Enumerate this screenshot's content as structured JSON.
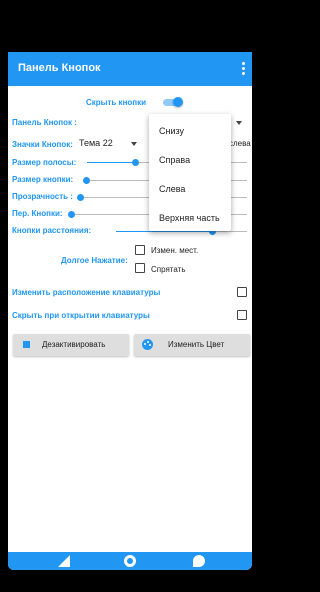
{
  "app": {
    "title": "Панель Кнопок"
  },
  "settings": {
    "hide_buttons_label": "Скрыть кнопки",
    "hide_buttons_on": true,
    "panel_label": "Панель Кнопок :",
    "icons_label": "Значки Кнопок:",
    "icons_theme": "Тема 22",
    "icons_partial_right": "слева",
    "sliders": [
      {
        "label": "Размер полосы:",
        "value": 0.32
      },
      {
        "label": "Размер кнопки:",
        "value": 0.02
      },
      {
        "label": "Прозрачность :",
        "value": 0.0
      },
      {
        "label": "Пер. Кнопки:",
        "value": 0.0
      },
      {
        "label": "Кнопки расстояния:",
        "value": 0.65
      }
    ],
    "long_press_label": "Долгое Нажатие:",
    "long_press_options": [
      {
        "label": "Измен. мест.",
        "checked": false
      },
      {
        "label": "Спрятать",
        "checked": false
      }
    ],
    "toggle_rows": [
      {
        "label": "Изменить расположение клавиатуры",
        "checked": false
      },
      {
        "label": "Скрыть при открытии клавиатуры",
        "checked": false
      }
    ],
    "buttons": {
      "deactivate": "Дезактивировать",
      "change_color": "Изменить Цвет"
    }
  },
  "dropdown": {
    "options": [
      "Снизу",
      "Справа",
      "Слева",
      "Верхняя часть"
    ]
  },
  "bottom_nav": [
    "share-icon",
    "settings-icon",
    "cloud-icon"
  ],
  "colors": {
    "accent": "#2196f3",
    "background": "#000000"
  }
}
